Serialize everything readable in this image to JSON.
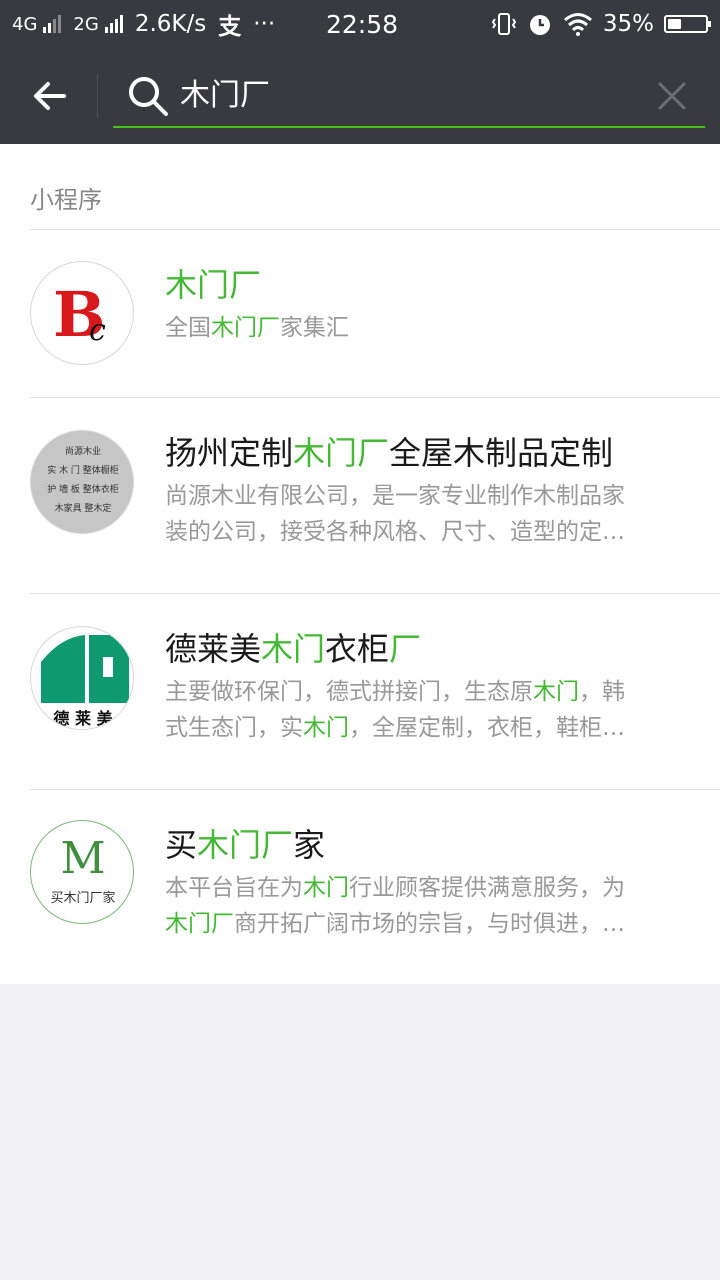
{
  "status_bar": {
    "net1": "4G",
    "net2": "2G",
    "speed": "2.6K/s",
    "app_glyph": "支",
    "more": "···",
    "time": "22:58",
    "battery_percent": "35%",
    "battery_level": 0.35,
    "icons": [
      "vibrate-icon",
      "alarm-icon",
      "wifi-icon",
      "battery-icon"
    ]
  },
  "search": {
    "query": "木门厂",
    "accent_color": "#45c01a"
  },
  "results": {
    "section_label": "小程序",
    "highlight_color": "#45b935",
    "items": [
      {
        "title_parts": [
          {
            "text": "木门厂",
            "hl": true
          }
        ],
        "desc_lines": [
          [
            {
              "text": "全国",
              "hl": false
            },
            {
              "text": "木门厂",
              "hl": true
            },
            {
              "text": "家集汇",
              "hl": false
            }
          ]
        ],
        "avatar_text": "Bc"
      },
      {
        "title_parts": [
          {
            "text": "扬州定制",
            "hl": false
          },
          {
            "text": "木门厂",
            "hl": true
          },
          {
            "text": "全屋木制品定制",
            "hl": false
          }
        ],
        "desc_lines": [
          [
            {
              "text": "尚源木业有限公司，是一家专业制作木制品家",
              "hl": false
            }
          ],
          [
            {
              "text": "装的公司，接受各种风格、尺寸、造型的定…",
              "hl": false
            }
          ]
        ],
        "avatar_lines": [
          "尚源木业",
          "实 木 门  整体橱柜",
          "护 墙 板  整体衣柜",
          "木家具  整木定"
        ]
      },
      {
        "title_parts": [
          {
            "text": "德莱美",
            "hl": false
          },
          {
            "text": "木门",
            "hl": true
          },
          {
            "text": "衣柜",
            "hl": false
          },
          {
            "text": "厂",
            "hl": true
          }
        ],
        "desc_lines": [
          [
            {
              "text": "主要做环保门，德式拼接门，生态原",
              "hl": false
            },
            {
              "text": "木门",
              "hl": true
            },
            {
              "text": "，韩",
              "hl": false
            }
          ],
          [
            {
              "text": "式生态门，实",
              "hl": false
            },
            {
              "text": "木门",
              "hl": true
            },
            {
              "text": "，全屋定制，衣柜，鞋柜…",
              "hl": false
            }
          ]
        ],
        "avatar_text": "德 莱 美"
      },
      {
        "title_parts": [
          {
            "text": "买",
            "hl": false
          },
          {
            "text": "木门厂",
            "hl": true
          },
          {
            "text": "家",
            "hl": false
          }
        ],
        "desc_lines": [
          [
            {
              "text": "本平台旨在为",
              "hl": false
            },
            {
              "text": "木门",
              "hl": true
            },
            {
              "text": "行业顾客提供满意服务，为",
              "hl": false
            }
          ],
          [
            {
              "text": "木门厂",
              "hl": true
            },
            {
              "text": "商开拓广阔市场的宗旨，与时俱进，…",
              "hl": false
            }
          ]
        ],
        "avatar_mark": "M",
        "avatar_text": "买木门厂家"
      }
    ]
  }
}
